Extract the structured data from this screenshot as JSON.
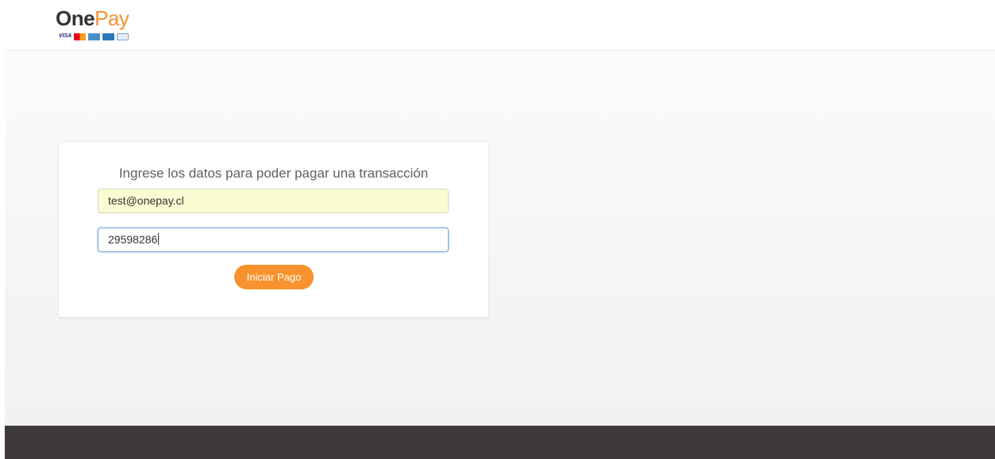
{
  "header": {
    "logo": {
      "one": "One",
      "pay": "Pay",
      "card_brands": [
        "VISA",
        "mastercard",
        "maestro",
        "amex",
        "diners"
      ]
    }
  },
  "form": {
    "title": "Ingrese los datos para poder pagar una transacción",
    "email_value": "test@onepay.cl",
    "id_value": "29598286",
    "submit_label": "Iniciar Pago"
  },
  "colors": {
    "accent": "#f7922d",
    "footer": "#3e3a3b",
    "autofill": "#fafbd2",
    "focus_border": "#7aa7e0"
  }
}
